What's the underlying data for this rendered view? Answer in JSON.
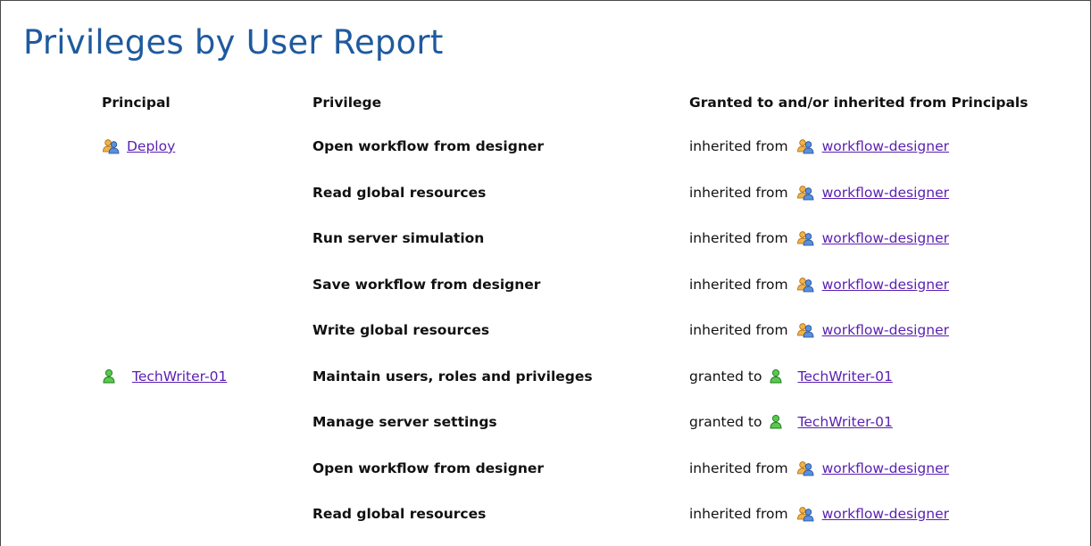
{
  "page": {
    "title": "Privileges by User Report"
  },
  "table": {
    "headers": {
      "principal": "Principal",
      "privilege": "Privilege",
      "granted": "Granted to and/or inherited from Principals"
    },
    "rows": [
      {
        "principal": "Deploy",
        "principal_icon": "group-icon",
        "privilege": "Open workflow from designer",
        "prefix": "inherited from",
        "source": "workflow-designer",
        "source_icon": "group-icon"
      },
      {
        "principal": "",
        "privilege": "Read global resources",
        "prefix": "inherited from",
        "source": "workflow-designer",
        "source_icon": "group-icon"
      },
      {
        "principal": "",
        "privilege": "Run server simulation",
        "prefix": "inherited from",
        "source": "workflow-designer",
        "source_icon": "group-icon"
      },
      {
        "principal": "",
        "privilege": "Save workflow from designer",
        "prefix": "inherited from",
        "source": "workflow-designer",
        "source_icon": "group-icon"
      },
      {
        "principal": "",
        "privilege": "Write global resources",
        "prefix": "inherited from",
        "source": "workflow-designer",
        "source_icon": "group-icon"
      },
      {
        "principal": "TechWriter-01",
        "principal_icon": "user-icon",
        "privilege": "Maintain users, roles and privileges",
        "prefix": "granted to",
        "source": "TechWriter-01",
        "source_icon": "user-icon"
      },
      {
        "principal": "",
        "privilege": "Manage server settings",
        "prefix": "granted to",
        "source": "TechWriter-01",
        "source_icon": "user-icon"
      },
      {
        "principal": "",
        "privilege": "Open workflow from designer",
        "prefix": "inherited from",
        "source": "workflow-designer",
        "source_icon": "group-icon"
      },
      {
        "principal": "",
        "privilege": "Read global resources",
        "prefix": "inherited from",
        "source": "workflow-designer",
        "source_icon": "group-icon"
      }
    ]
  },
  "colors": {
    "title": "#1f5a9e",
    "link": "#5a1fb2",
    "group_icon_orange": "#e8a23a",
    "group_icon_blue": "#3a6fc4",
    "user_icon_green": "#3aa834"
  }
}
